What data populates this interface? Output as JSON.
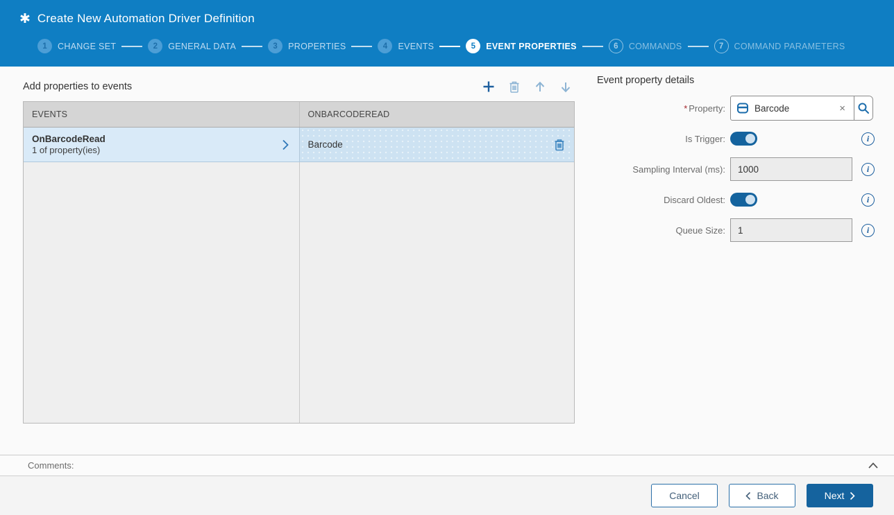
{
  "header": {
    "title": "Create New Automation Driver Definition",
    "steps": [
      {
        "number": "1",
        "label": "CHANGE SET",
        "state": "done"
      },
      {
        "number": "2",
        "label": "GENERAL DATA",
        "state": "done"
      },
      {
        "number": "3",
        "label": "PROPERTIES",
        "state": "done"
      },
      {
        "number": "4",
        "label": "EVENTS",
        "state": "done"
      },
      {
        "number": "5",
        "label": "EVENT PROPERTIES",
        "state": "active"
      },
      {
        "number": "6",
        "label": "COMMANDS",
        "state": "future"
      },
      {
        "number": "7",
        "label": "COMMAND PARAMETERS",
        "state": "future"
      }
    ]
  },
  "left_panel": {
    "title": "Add properties to events",
    "toolbar_icons": [
      "plus-icon",
      "trash-icon",
      "arrow-up-icon",
      "arrow-down-icon"
    ],
    "table": {
      "columns": [
        "EVENTS",
        "ONBARCODEREAD"
      ],
      "rows": [
        {
          "event": "OnBarcodeRead",
          "event_sub": "1 of property(ies)",
          "property": "Barcode"
        }
      ]
    }
  },
  "details": {
    "title": "Event property details",
    "property": {
      "required_marker": "*",
      "label": "Property:",
      "value": "Barcode",
      "clear_glyph": "×",
      "icons": [
        "property-box-icon",
        "search-icon"
      ]
    },
    "is_trigger": {
      "label": "Is Trigger:",
      "value": "on"
    },
    "sampling_interval": {
      "label": "Sampling Interval (ms):",
      "value": "1000"
    },
    "discard_oldest": {
      "label": "Discard Oldest:",
      "value": "on"
    },
    "queue_size": {
      "label": "Queue Size:",
      "value": "1"
    }
  },
  "comments": {
    "label": "Comments:"
  },
  "footer": {
    "cancel_label": "Cancel",
    "back_label": "Back",
    "next_label": "Next"
  },
  "colors": {
    "header_bg": "#0f7ec3",
    "accent_blue": "#1b6cab",
    "toggle_on": "#14639e",
    "selected_row_left": "#d9eaf8",
    "selected_row_right": "#cde2f2",
    "primary_button": "#15639e",
    "required_marker": "#a4262c"
  }
}
